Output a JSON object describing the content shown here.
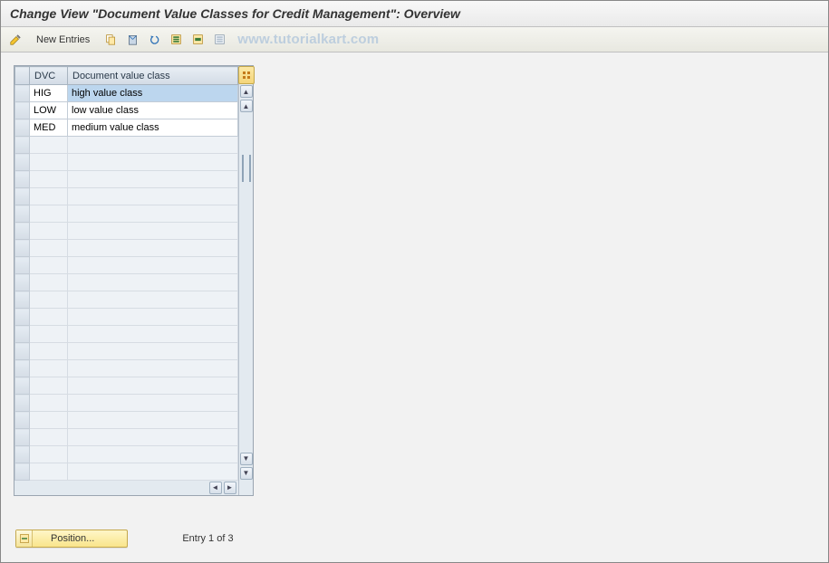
{
  "title": "Change View \"Document Value Classes for Credit Management\": Overview",
  "watermark": "www.tutorialkart.com",
  "toolbar": {
    "new_entries_label": "New Entries"
  },
  "table": {
    "columns": {
      "dvc": "DVC",
      "desc": "Document value class"
    },
    "rows": [
      {
        "dvc": "HIG",
        "desc": "high value class",
        "highlighted": true
      },
      {
        "dvc": "LOW",
        "desc": "low value class",
        "highlighted": false
      },
      {
        "dvc": "MED",
        "desc": "medium value class",
        "highlighted": false
      }
    ],
    "empty_rows": 20
  },
  "footer": {
    "position_label": "Position...",
    "entry_text": "Entry 1 of 3"
  }
}
